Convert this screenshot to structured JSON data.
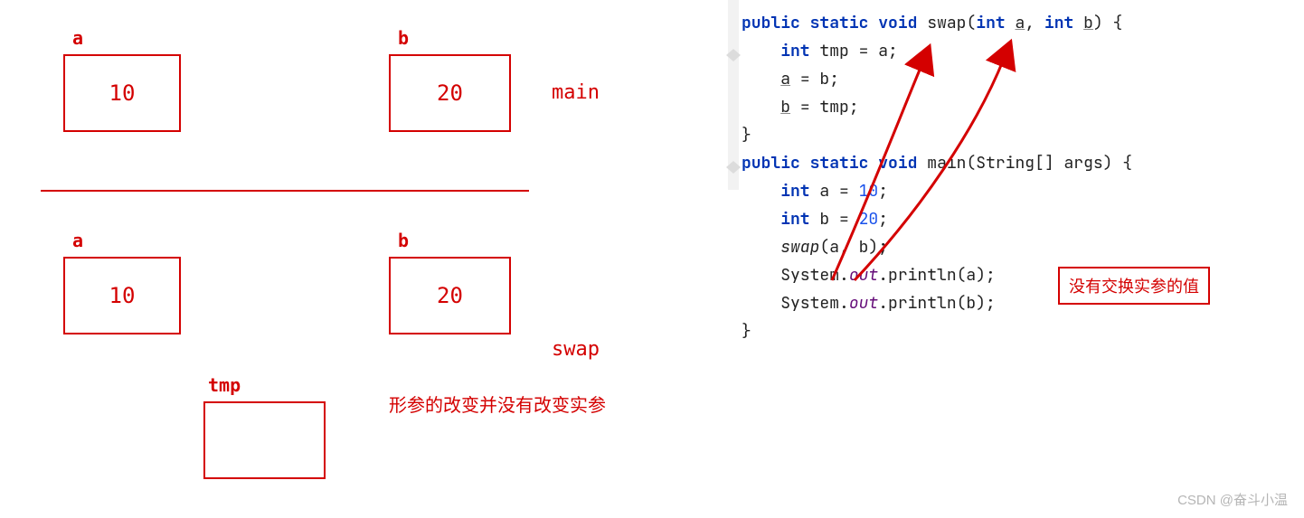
{
  "diagram": {
    "main": {
      "scopeLabel": "main",
      "a": {
        "label": "a",
        "value": "10"
      },
      "b": {
        "label": "b",
        "value": "20"
      }
    },
    "swap": {
      "scopeLabel": "swap",
      "a": {
        "label": "a",
        "value": "10"
      },
      "b": {
        "label": "b",
        "value": "20"
      },
      "tmp": {
        "label": "tmp",
        "value": ""
      }
    },
    "caption": "形参的改变并没有改变实参"
  },
  "callout": "没有交换实参的值",
  "code": {
    "l1": {
      "kw1": "public",
      "kw2": "static",
      "kw3": "void",
      "fn": "swap",
      "p": "(",
      "kw4": "int",
      "a": "a",
      "c": ", ",
      "kw5": "int",
      "b": "b",
      "br": ") {"
    },
    "l2": {
      "ind": "    ",
      "kw": "int",
      "rest": " tmp = a;"
    },
    "l3": {
      "ind": "    ",
      "a": "a",
      "rest": " = b;"
    },
    "l4": {
      "ind": "    ",
      "b": "b",
      "rest": " = tmp;"
    },
    "l5": "}",
    "l6": "",
    "l7": {
      "kw1": "public",
      "kw2": "static",
      "kw3": "void",
      "fn": "main",
      "rest": "(String[] args) {"
    },
    "l8": {
      "ind": "    ",
      "kw": "int",
      "mid": " a = ",
      "num": "10",
      "post": ";"
    },
    "l9": {
      "ind": "    ",
      "kw": "int",
      "mid": " b = ",
      "num": "20",
      "post": ";"
    },
    "l10": {
      "ind": "    ",
      "fn": "swap",
      "rest": "(a, b);"
    },
    "l11a": {
      "ind": "    ",
      "pre": "System.",
      "out": "out",
      "rest": ".println(a);"
    },
    "l11b": {
      "ind": "    ",
      "pre": "System.",
      "out": "out",
      "rest": ".println(b);"
    },
    "l12": "}"
  },
  "watermark": "CSDN @奋斗小温"
}
